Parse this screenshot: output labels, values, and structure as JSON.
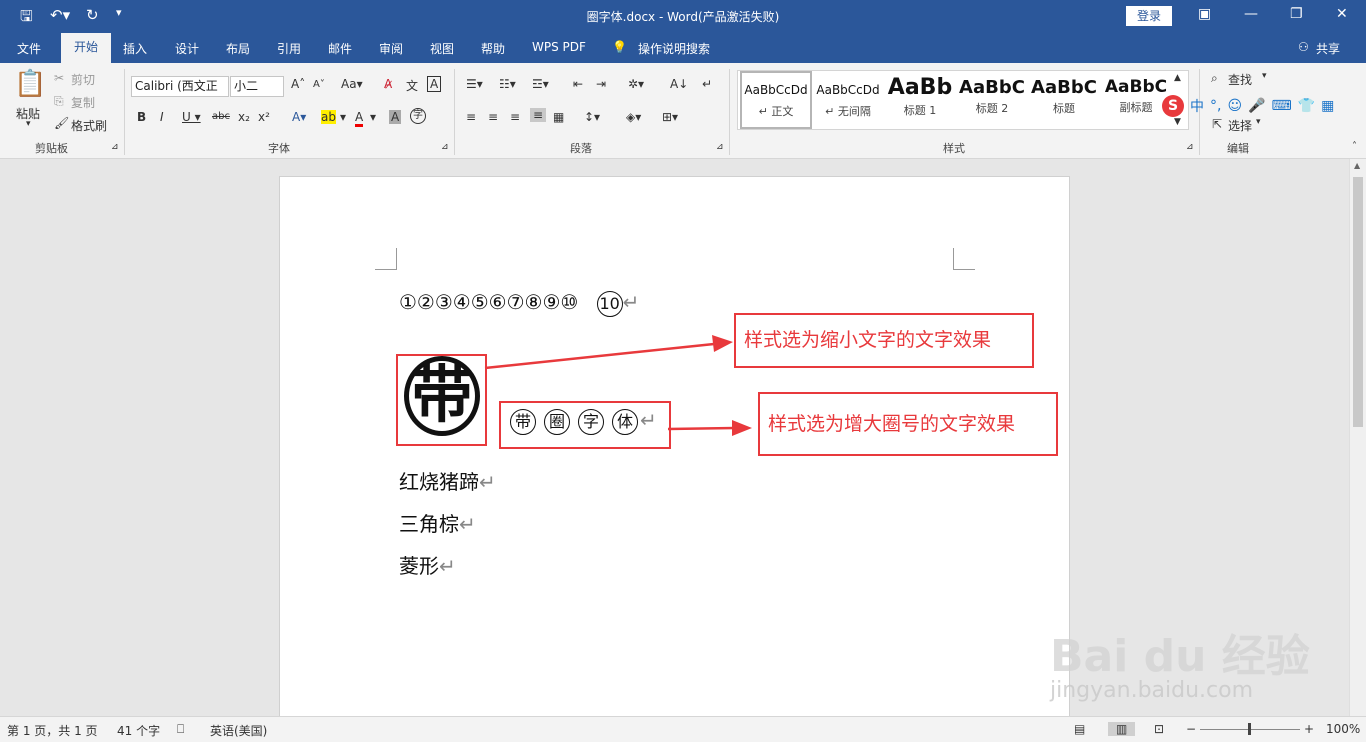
{
  "window": {
    "title": "圈字体.docx - Word(产品激活失败)",
    "login": "登录",
    "share": "共享"
  },
  "tabs": [
    "文件",
    "开始",
    "插入",
    "设计",
    "布局",
    "引用",
    "邮件",
    "审阅",
    "视图",
    "帮助",
    "WPS PDF",
    "操作说明搜索"
  ],
  "ribbon": {
    "clipboard": {
      "paste": "粘贴",
      "cut": "剪切",
      "copy": "复制",
      "format_painter": "格式刷",
      "label": "剪贴板"
    },
    "font": {
      "name": "Calibri (西文正",
      "size": "小二",
      "label": "字体"
    },
    "paragraph": {
      "label": "段落"
    },
    "styles": {
      "label": "样式",
      "items": [
        {
          "sample": "AaBbCcDd",
          "name": "↵ 正文"
        },
        {
          "sample": "AaBbCcDd",
          "name": "↵ 无间隔"
        },
        {
          "sample": "AaBb",
          "name": "标题 1"
        },
        {
          "sample": "AaBbC",
          "name": "标题 2"
        },
        {
          "sample": "AaBbC",
          "name": "标题"
        },
        {
          "sample": "AaBbC",
          "name": "副标题"
        }
      ]
    },
    "editing": {
      "find": "查找",
      "select": "选择",
      "label": "编辑"
    }
  },
  "ime": {
    "lang": "中"
  },
  "document": {
    "line1": "①②③④⑤⑥⑦⑧⑨⑩",
    "line1_extra": "10",
    "big_char": "带",
    "circled": [
      "带",
      "圈",
      "字",
      "体"
    ],
    "line3": "红烧猪蹄",
    "line4": "三角棕",
    "line5": "菱形",
    "paragraph_mark": "↵"
  },
  "annotations": {
    "a1": "样式选为缩小文字的文字效果",
    "a2": "样式选为增大圈号的文字效果"
  },
  "status": {
    "page": "第 1 页，共 1 页",
    "words": "41 个字",
    "lang": "英语(美国)",
    "zoom": "100%"
  },
  "watermark": {
    "brand": "Bai du 经验",
    "url": "jingyan.baidu.com"
  },
  "colors": {
    "titlebar": "#2b579a",
    "annotation": "#e8393c"
  }
}
